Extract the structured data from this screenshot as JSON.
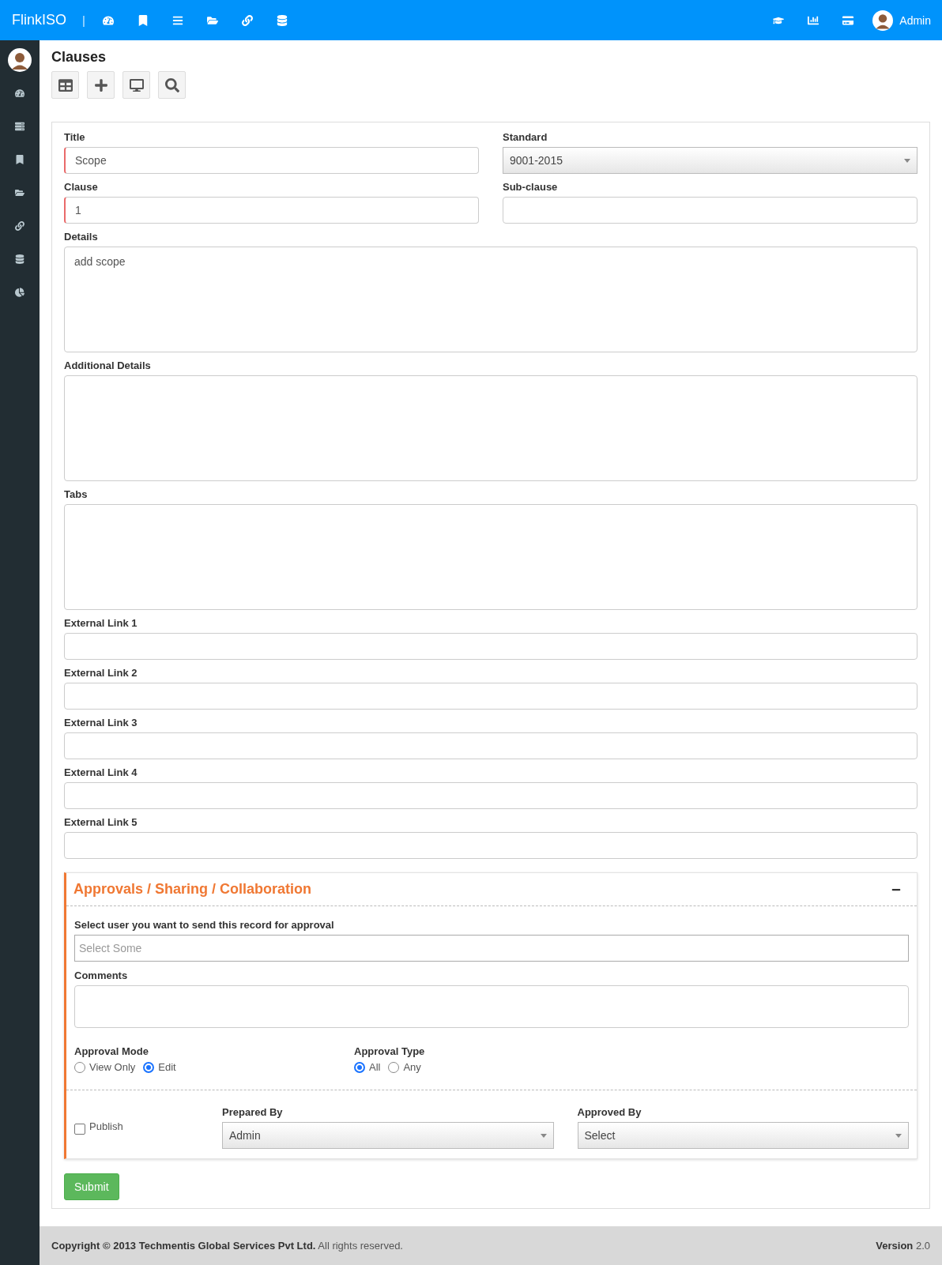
{
  "topbar": {
    "brand": "FlinkISO",
    "separator": "|",
    "user_name": "Admin"
  },
  "page": {
    "title": "Clauses"
  },
  "fields": [
    {
      "kind": "input",
      "label": "Title",
      "value": "Scope",
      "half": true,
      "required": true
    },
    {
      "kind": "select",
      "label": "Standard",
      "value": "9001-2015",
      "half": true,
      "required": false
    },
    {
      "kind": "input",
      "label": "Clause",
      "value": "1",
      "half": true,
      "required": true
    },
    {
      "kind": "input",
      "label": "Sub-clause",
      "half": true,
      "required": false
    },
    {
      "kind": "textarea",
      "label": "Details",
      "value": "add scope",
      "half": false,
      "required": false
    },
    {
      "kind": "textarea",
      "label": "Additional Details",
      "half": false,
      "required": false
    },
    {
      "kind": "textarea",
      "label": "Tabs",
      "half": false,
      "required": false
    },
    {
      "kind": "input",
      "label": "External Link 1",
      "half": false,
      "required": false
    },
    {
      "kind": "input",
      "label": "External Link 2",
      "half": false,
      "required": false
    },
    {
      "kind": "input",
      "label": "External Link 3",
      "half": false,
      "required": false
    },
    {
      "kind": "input",
      "label": "External Link 4",
      "half": false,
      "required": false
    },
    {
      "kind": "input",
      "label": "External Link 5",
      "half": false,
      "required": false
    }
  ],
  "approvals": {
    "title": "Approvals / Sharing / Collaboration",
    "expanded": true,
    "approver": {
      "label": "Select user you want to send this record for approval",
      "placeholder": "Select Some"
    },
    "comments": {
      "label": "Comments"
    },
    "approval_mode": {
      "label": "Approval Mode",
      "options": [
        {
          "label": "View Only",
          "selected": false
        },
        {
          "label": "Edit",
          "selected": true
        }
      ]
    },
    "approval_type": {
      "label": "Approval Type",
      "options": [
        {
          "label": "All",
          "selected": true
        },
        {
          "label": "Any",
          "selected": false
        }
      ]
    },
    "publish": {
      "label": "Publish",
      "checked": false
    },
    "prepared_by": {
      "label": "Prepared By",
      "value": "Admin"
    },
    "approved_by": {
      "label": "Approved By",
      "value": "Select"
    }
  },
  "submit": "Submit",
  "footer": {
    "copyright": "**Copyright © 2013 Techmentis Global Services Pvt Ltd.** All rights reserved.",
    "version": "**Version** 2.0"
  }
}
